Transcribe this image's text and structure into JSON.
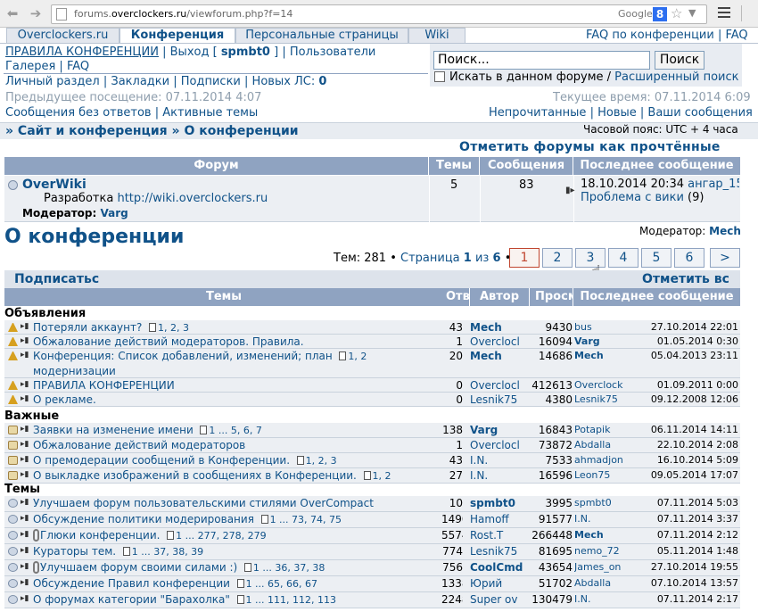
{
  "browser": {
    "url_prefix": "forums.",
    "url_domain": "overclockers.ru",
    "url_path": "/viewforum.php?f=14",
    "search_engine": "Google",
    "search_badge": "8"
  },
  "tabs": [
    "Overclockers.ru",
    "Конференция",
    "Персональные страницы",
    "Wiki"
  ],
  "top_right_links": [
    "FAQ по конференции",
    "FAQ"
  ],
  "user_links": {
    "rules": "ПРАВИЛА КОНФЕРЕНЦИИ",
    "logout": "Выход [",
    "username": "spmbt0",
    "logout_close": "]",
    "users": "Пользователи",
    "gallery": "Галерея",
    "faq": "FAQ",
    "personal": "Личный раздел",
    "bookmarks": "Закладки",
    "subscriptions": "Подписки",
    "new_pm": "Новых ЛС:",
    "new_pm_count": "0"
  },
  "search": {
    "placeholder": "Поиск...",
    "button": "Поиск",
    "in_forum": "Искать в данном форуме /",
    "advanced": "Расширенный поиск"
  },
  "visits": {
    "prev": "Предыдущее посещение: 07.11.2014 4:07",
    "current": "Текущее время: 07.11.2014 6:09"
  },
  "quick_links": {
    "no_answers": "Сообщения без ответов",
    "active": "Активные темы",
    "unread": "Непрочитанные",
    "new": "Новые",
    "yours": "Ваши сообщения"
  },
  "timezone": "Часовой пояс: UTC + 4 часа",
  "breadcrumb": [
    "Сайт и конференция",
    "О конференции"
  ],
  "mark_read": "Отметить форумы как прочтённые",
  "forum_headers": [
    "Форум",
    "Темы",
    "Сообщения",
    "Последнее сообщение"
  ],
  "subforum": {
    "name": "OverWiki",
    "desc": "Разработка",
    "desc_link": "http://wiki.overclockers.ru",
    "mod_label": "Модератор:",
    "moderator": "Varg",
    "topics": "5",
    "posts": "83",
    "last_date": "18.10.2014 20:34",
    "last_user": "ангар_15",
    "last_topic": "Проблема с вики",
    "last_count": "(9)"
  },
  "page_title": "О конференции",
  "moderator_line": {
    "label": "Модератор:",
    "name": "Mech"
  },
  "pagination": {
    "total_label": "Тем: 281 •",
    "page_label": "Страница",
    "current": "1",
    "of": "из",
    "total": "6",
    "bullet": "•",
    "pages": [
      "1",
      "2",
      "3",
      "4",
      "5",
      "6",
      ">"
    ]
  },
  "actions": {
    "subscribe": "Подписатьс",
    "mark": "Отметить вс"
  },
  "topic_headers": [
    "Темы",
    "Отв",
    "Автор",
    "Просм",
    "Последнее сообщение"
  ],
  "sections": {
    "ann": "Объявления",
    "imp": "Важные",
    "topics": "Темы"
  },
  "announcements": [
    {
      "title": "Потеряли аккаунт?",
      "pages": "1, 2, 3",
      "replies": "43",
      "author": "Mech",
      "views": "9430",
      "last_user": "bus",
      "last_date": "27.10.2014 22:01"
    },
    {
      "title": "Обжалование действий модераторов. Правила.",
      "pages": "",
      "replies": "1",
      "author": "Overclocl",
      "views": "16094",
      "last_user": "Varg",
      "last_date": "01.05.2014 0:30"
    },
    {
      "title": "Конференция: Список добавлений, изменений; план",
      "title2": "модернизации",
      "pages": "1, 2",
      "replies": "20",
      "author": "Mech",
      "views": "14686",
      "last_user": "Mech",
      "last_date": "05.04.2013 23:11"
    },
    {
      "title": "ПРАВИЛА КОНФЕРЕНЦИИ",
      "pages": "",
      "replies": "0",
      "author": "Overclocl",
      "views": "412613",
      "last_user": "Overclock",
      "last_date": "01.09.2011 0:00"
    },
    {
      "title": "О рекламе.",
      "pages": "",
      "replies": "0",
      "author": "Lesnik75",
      "views": "4380",
      "last_user": "Lesnik75",
      "last_date": "09.12.2008 12:06"
    }
  ],
  "important": [
    {
      "title": "Заявки на изменение имени",
      "pages": "1 ... 5, 6, 7",
      "replies": "138",
      "author": "Varg",
      "views": "16843",
      "last_user": "Potapik",
      "last_date": "06.11.2014 14:11"
    },
    {
      "title": "Обжалование действий модераторов",
      "pages": "",
      "replies": "1",
      "author": "Overclocl",
      "views": "73872",
      "last_user": "Abdalla",
      "last_date": "22.10.2014 2:08"
    },
    {
      "title": "О премодерации сообщений в Конференции.",
      "pages": "1, 2, 3",
      "replies": "43",
      "author": "I.N.",
      "views": "7533",
      "last_user": "ahmadjon",
      "last_date": "16.10.2014 5:09"
    },
    {
      "title": "О выкладке изображений в сообщениях в Конференции.",
      "pages": "1, 2",
      "replies": "27",
      "author": "I.N.",
      "views": "16596",
      "last_user": "Leon75",
      "last_date": "09.05.2014 17:07"
    }
  ],
  "topics": [
    {
      "title": "Улучшаем форум пользовательскими стилями OverCompact",
      "pages": "",
      "replies": "10",
      "author": "spmbt0",
      "views": "3995",
      "last_user": "spmbt0",
      "last_date": "07.11.2014 5:03"
    },
    {
      "title": "Обсуждение политики модерирования",
      "pages": "1 ... 73, 74, 75",
      "replies": "1490",
      "author": "Hamoff",
      "views": "91577",
      "last_user": "I.N.",
      "last_date": "07.11.2014 3:37"
    },
    {
      "title": "Глюки конференции.",
      "pages": "1 ... 277, 278, 279",
      "replies": "5574",
      "author": "Rost.T",
      "views": "266448",
      "last_user": "Mech",
      "last_date": "07.11.2014 2:12",
      "clip": true
    },
    {
      "title": "Кураторы тем.",
      "pages": "1 ... 37, 38, 39",
      "replies": "774",
      "author": "Lesnik75",
      "views": "81695",
      "last_user": "nemo_72",
      "last_date": "05.11.2014 1:48"
    },
    {
      "title": "Улучшаем форум своими силами :)",
      "pages": "1 ... 36, 37, 38",
      "replies": "756",
      "author": "CoolCmd",
      "views": "43654",
      "last_user": "James_on",
      "last_date": "27.10.2014 19:55",
      "clip": true
    },
    {
      "title": "Обсуждение Правил конференции",
      "pages": "1 ... 65, 66, 67",
      "replies": "1338",
      "author": "Юрий",
      "views": "51702",
      "last_user": "Abdalla",
      "last_date": "07.10.2014 13:57"
    },
    {
      "title": "О форумах категории \"Барахолка\"",
      "pages": "1 ... 111, 112, 113",
      "replies": "2248",
      "author": "Super ov",
      "views": "130479",
      "last_user": "I.N.",
      "last_date": "07.11.2014 2:17"
    }
  ]
}
